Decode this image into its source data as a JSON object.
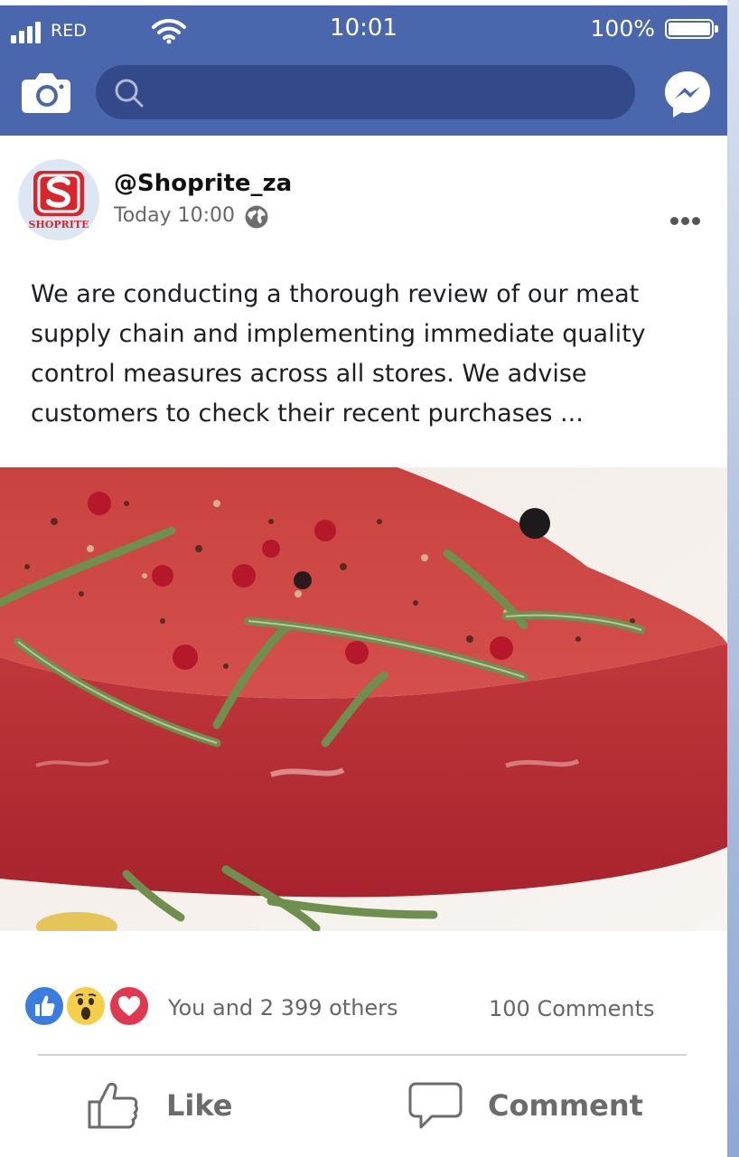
{
  "status_bar": {
    "carrier": "RED",
    "time": "10:01",
    "battery": "100%"
  },
  "top_bar": {
    "search_placeholder": ""
  },
  "post": {
    "author": "@Shoprite_za",
    "timestamp": "Today 10:00",
    "avatar_text": "SHOPRITE",
    "text": "We are conducting a thorough review of our meat supply chain and implementing immediate quality control measures across all stores. We advise customers to check their recent purchases ...",
    "likes_text": "You and 2 399 others",
    "comments_count": "100 Comments",
    "reactions": [
      "like-icon",
      "wow-icon",
      "love-icon"
    ]
  },
  "actions": {
    "like_label": "Like",
    "comment_label": "Comment"
  },
  "colors": {
    "header_bg": "#4a67ad",
    "search_bg": "#33498a",
    "brand_red": "#d8262c",
    "like_blue": "#3b7ddd",
    "love_red": "#e0394f"
  }
}
